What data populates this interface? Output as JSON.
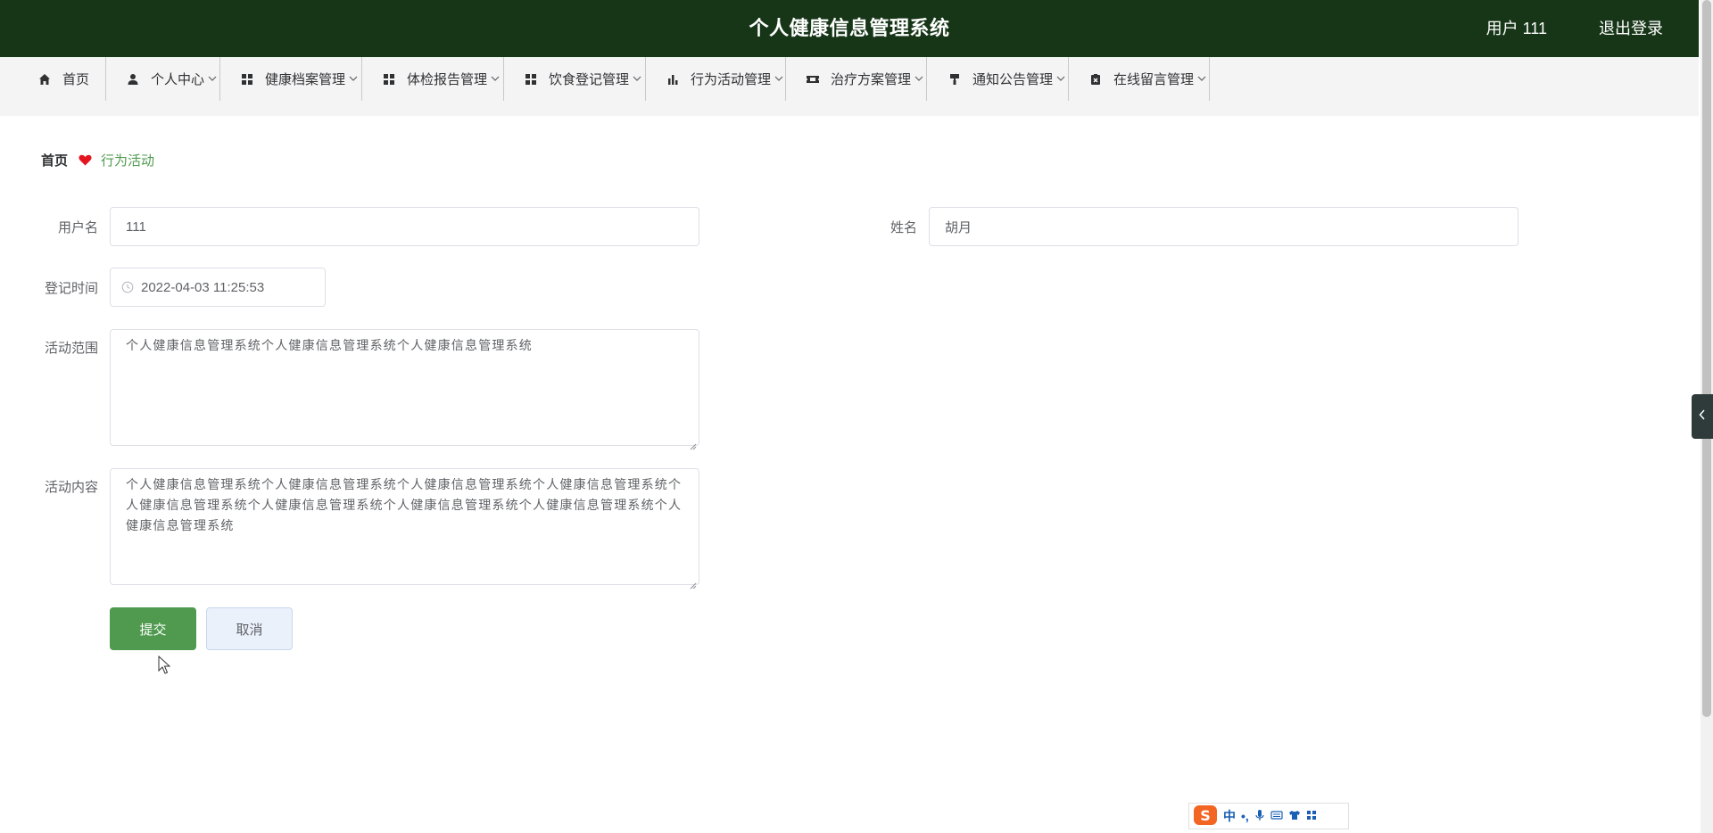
{
  "header": {
    "title": "个人健康信息管理系统",
    "user": "用户 111",
    "logout": "退出登录"
  },
  "nav": {
    "items": [
      {
        "label": "首页",
        "icon": "home-icon"
      },
      {
        "label": "个人中心",
        "icon": "user-icon"
      },
      {
        "label": "健康档案管理",
        "icon": "grid-icon"
      },
      {
        "label": "体检报告管理",
        "icon": "grid-icon"
      },
      {
        "label": "饮食登记管理",
        "icon": "grid-icon"
      },
      {
        "label": "行为活动管理",
        "icon": "bar-chart-icon"
      },
      {
        "label": "治疗方案管理",
        "icon": "ticket-icon"
      },
      {
        "label": "通知公告管理",
        "icon": "paint-roller-icon"
      },
      {
        "label": "在线留言管理",
        "icon": "clipboard-x-icon"
      }
    ]
  },
  "breadcrumb": {
    "home": "首页",
    "current": "行为活动"
  },
  "form": {
    "username_label": "用户名",
    "username_value": "111",
    "name_label": "姓名",
    "name_value": "胡月",
    "time_label": "登记时间",
    "time_value": "2022-04-03 11:25:53",
    "scope_label": "活动范围",
    "scope_value": "个人健康信息管理系统个人健康信息管理系统个人健康信息管理系统",
    "content_label": "活动内容",
    "content_value": "个人健康信息管理系统个人健康信息管理系统个人健康信息管理系统个人健康信息管理系统个人健康信息管理系统个人健康信息管理系统个人健康信息管理系统个人健康信息管理系统个人健康信息管理系统",
    "submit": "提交",
    "cancel": "取消"
  },
  "ime": {
    "mode": "中",
    "punct": "•,"
  },
  "colors": {
    "header_bg": "#173618",
    "accent": "#4f9a4f",
    "nav_bg": "#f4f4f5"
  }
}
